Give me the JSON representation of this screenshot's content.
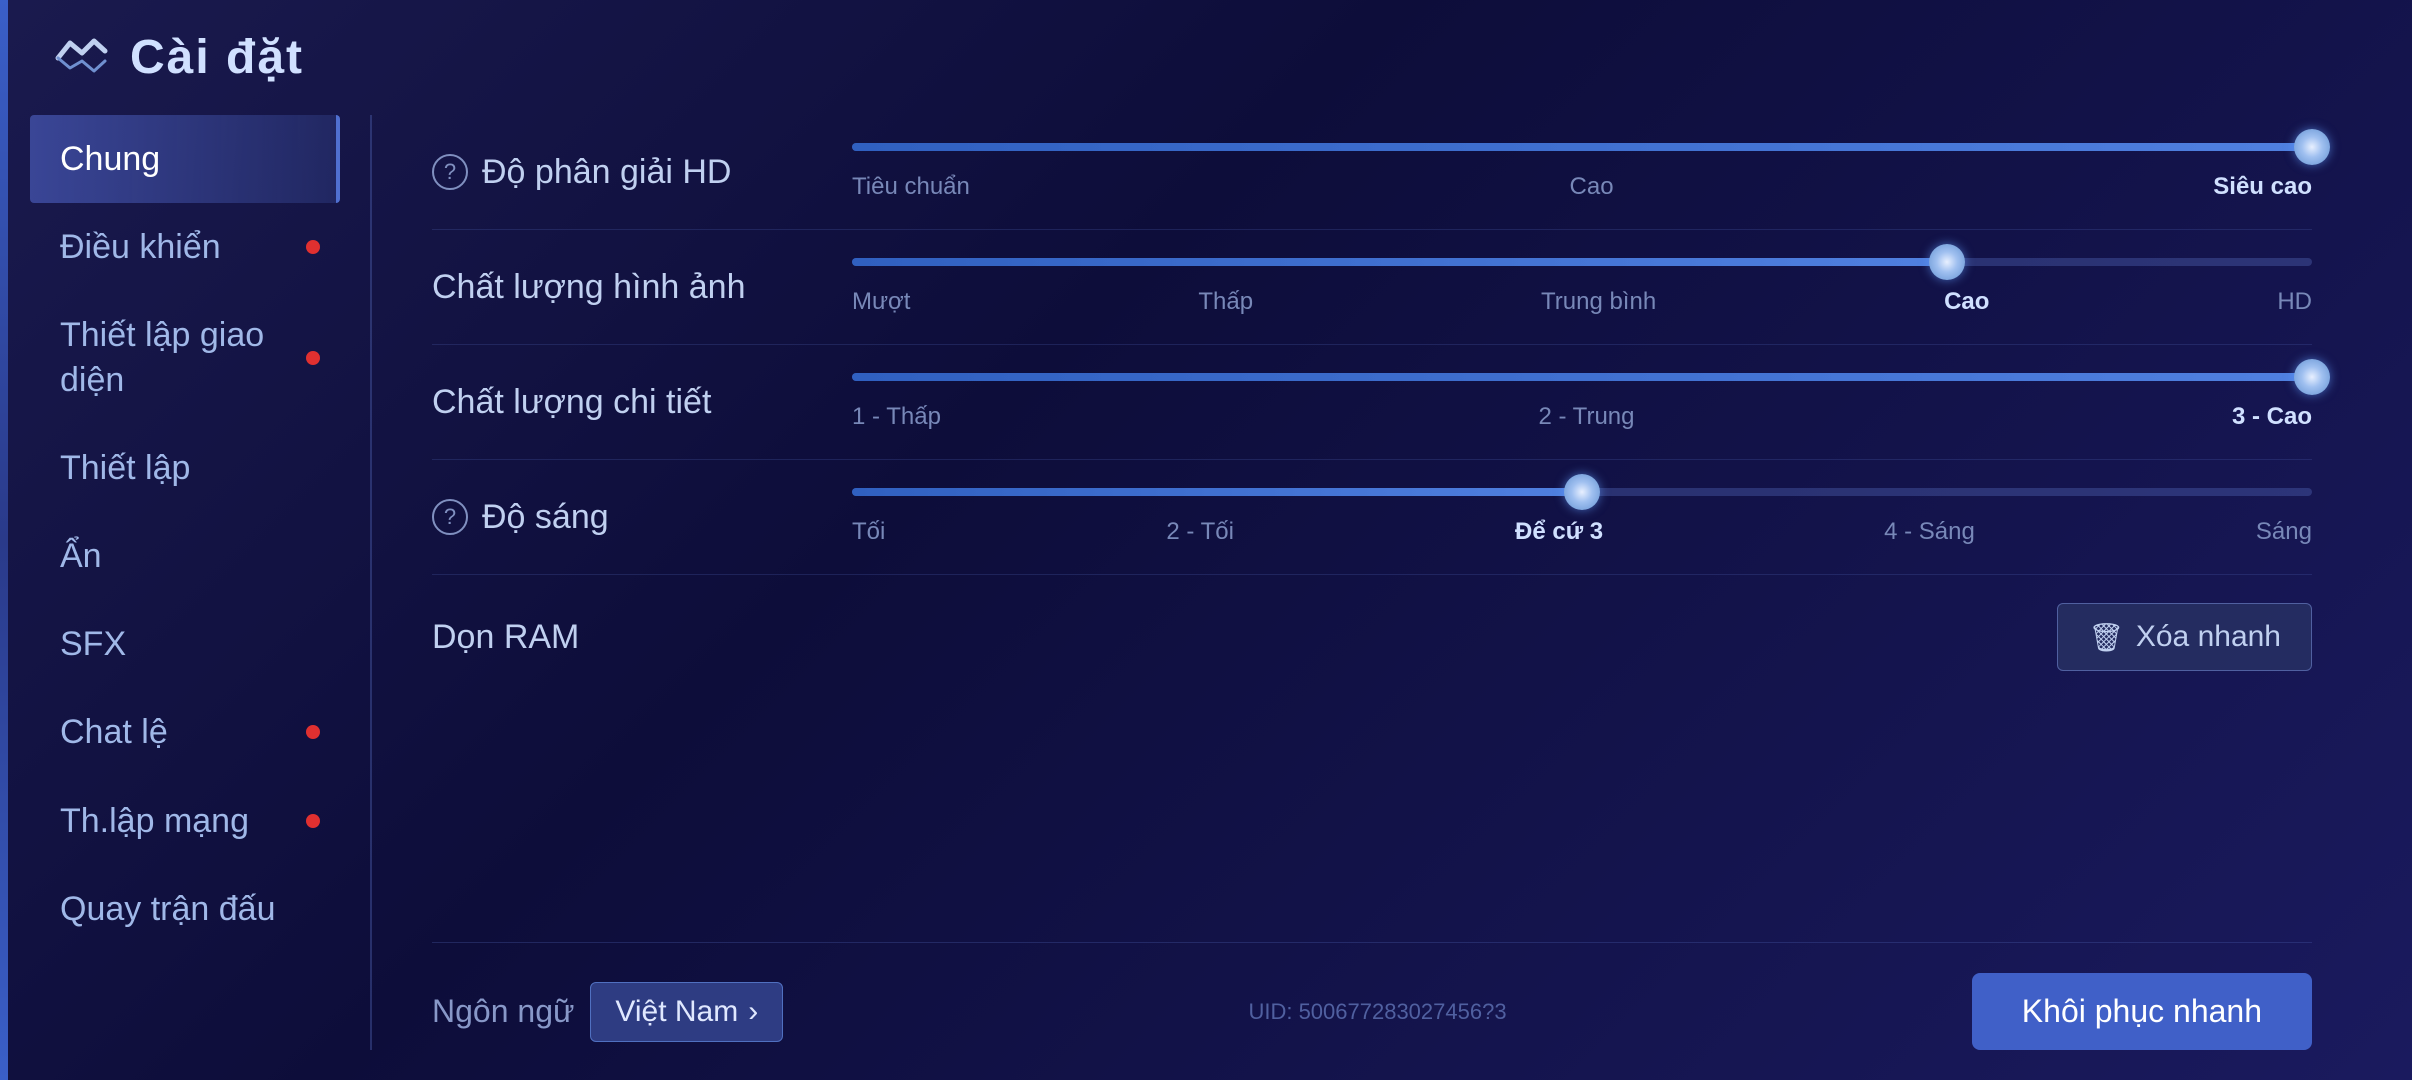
{
  "header": {
    "title": "Cài đặt",
    "logo_alt": "game-logo"
  },
  "sidebar": {
    "items": [
      {
        "id": "chung",
        "label": "Chung",
        "active": true,
        "has_dot": false
      },
      {
        "id": "dieu-khien",
        "label": "Điều khiển",
        "active": false,
        "has_dot": true
      },
      {
        "id": "thiet-lap-giao-dien",
        "label": "Thiết lập giao diện",
        "active": false,
        "has_dot": true
      },
      {
        "id": "thiet-lap",
        "label": "Thiết lập",
        "active": false,
        "has_dot": false
      },
      {
        "id": "an",
        "label": "Ẩn",
        "active": false,
        "has_dot": false
      },
      {
        "id": "sfx",
        "label": "SFX",
        "active": false,
        "has_dot": false
      },
      {
        "id": "chat-le",
        "label": "Chat lệ",
        "active": false,
        "has_dot": true
      },
      {
        "id": "th-lap-mang",
        "label": "Th.lập mạng",
        "active": false,
        "has_dot": true
      },
      {
        "id": "quay-tran-dau",
        "label": "Quay trận đấu",
        "active": false,
        "has_dot": false
      }
    ]
  },
  "settings": {
    "rows": [
      {
        "id": "do-phan-giai",
        "label": "Độ phân giải HD",
        "has_help": true,
        "type": "slider",
        "fill_percent": 100,
        "thumb_percent": 100,
        "markers": [
          {
            "label": "Tiêu chuẩn",
            "active": false
          },
          {
            "label": "Cao",
            "active": false
          },
          {
            "label": "Siêu cao",
            "active": true
          }
        ]
      },
      {
        "id": "chat-luong-hinh-anh",
        "label": "Chất lượng hình ảnh",
        "has_help": false,
        "type": "slider",
        "fill_percent": 75,
        "thumb_percent": 75,
        "markers": [
          {
            "label": "Mượt",
            "active": false
          },
          {
            "label": "Thấp",
            "active": false
          },
          {
            "label": "Trung bình",
            "active": false
          },
          {
            "label": "Cao",
            "active": true
          },
          {
            "label": "HD",
            "active": false
          }
        ]
      },
      {
        "id": "chat-luong-chi-tiet",
        "label": "Chất lượng chi tiết",
        "has_help": false,
        "type": "slider",
        "fill_percent": 100,
        "thumb_percent": 100,
        "markers": [
          {
            "label": "1 - Thấp",
            "active": false
          },
          {
            "label": "2 - Trung",
            "active": false
          },
          {
            "label": "3 - Cao",
            "active": true
          }
        ]
      },
      {
        "id": "do-sang",
        "label": "Độ sáng",
        "has_help": true,
        "type": "slider",
        "fill_percent": 50,
        "thumb_percent": 50,
        "markers": [
          {
            "label": "Tối",
            "active": false
          },
          {
            "label": "2 - Tối",
            "active": false
          },
          {
            "label": "Để cứ 3",
            "active": true
          },
          {
            "label": "4 - Sáng",
            "active": false
          },
          {
            "label": "Sáng",
            "active": false
          }
        ]
      },
      {
        "id": "don-ram",
        "label": "Dọn RAM",
        "has_help": false,
        "type": "button",
        "button_label": "Xóa nhanh"
      }
    ]
  },
  "footer": {
    "language_label": "Ngôn ngữ",
    "language_value": "Việt Nam",
    "language_chevron": "›",
    "uid_text": "UID: 500677283027456?3",
    "restore_label": "Khôi phục nhanh"
  }
}
